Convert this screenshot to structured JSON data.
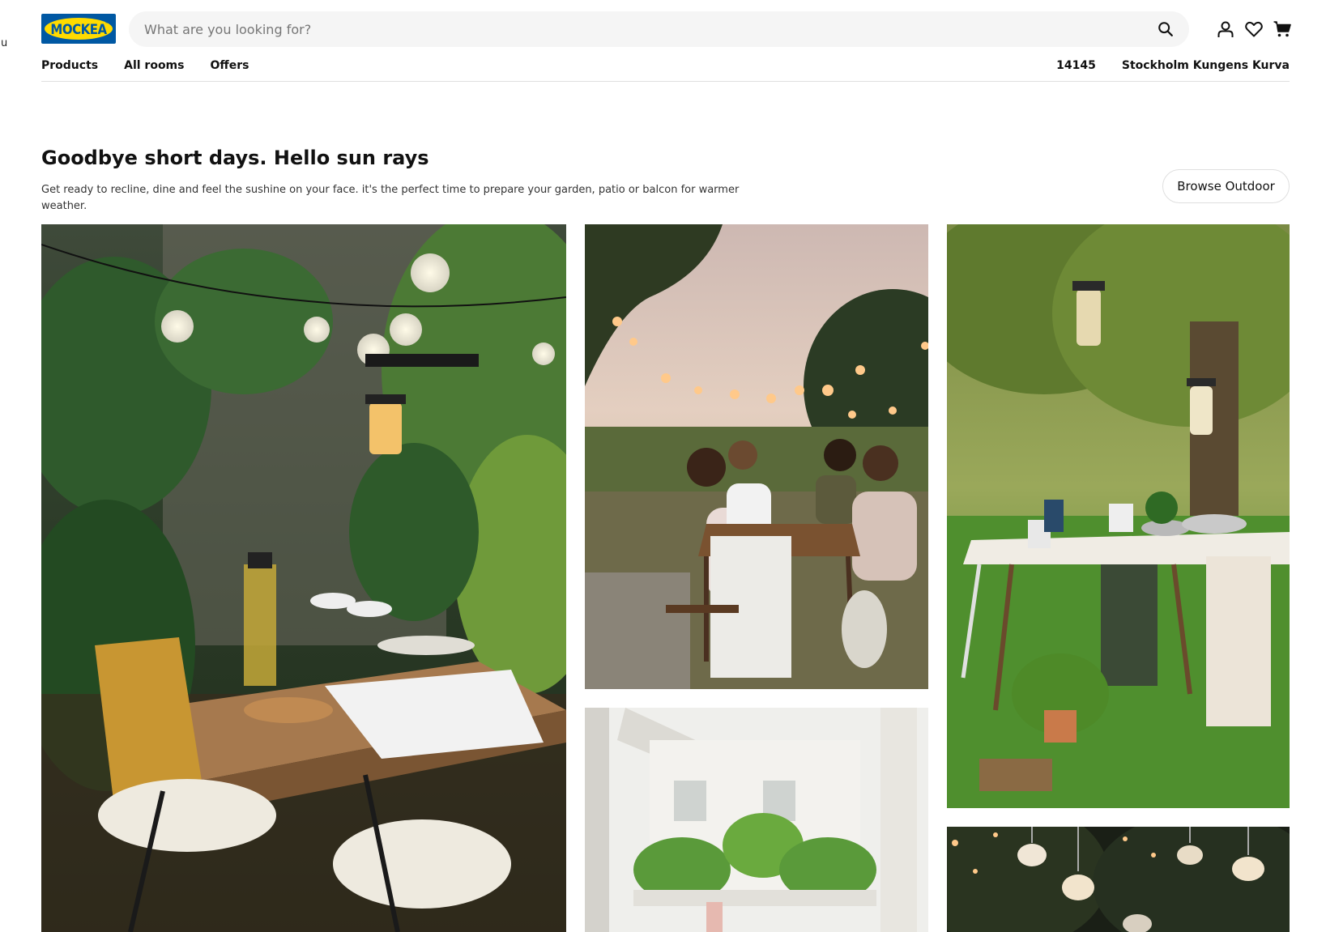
{
  "stray": "u",
  "logo": {
    "text": "MOCKEA",
    "reg": "®"
  },
  "search": {
    "placeholder": "What are you looking for?"
  },
  "icons": {
    "search": "search-icon",
    "user": "user-icon",
    "wishlist": "heart-icon",
    "cart": "cart-icon"
  },
  "nav": {
    "products": "Products",
    "rooms": "All rooms",
    "offers": "Offers"
  },
  "store": {
    "postcode": "14145",
    "name": "Stockholm Kungens Kurva"
  },
  "hero": {
    "title": "Goodbye short days. Hello sun rays",
    "subtitle": "Get ready to recline, dine and feel the sushine on your face. it's the perfect time to prepare your garden, patio or balcon for warmer weather.",
    "browse_label": "Browse Outdoor"
  },
  "colors": {
    "brand_blue": "#0058a3",
    "brand_yellow": "#ffdb00",
    "search_bg": "#f5f5f5"
  }
}
